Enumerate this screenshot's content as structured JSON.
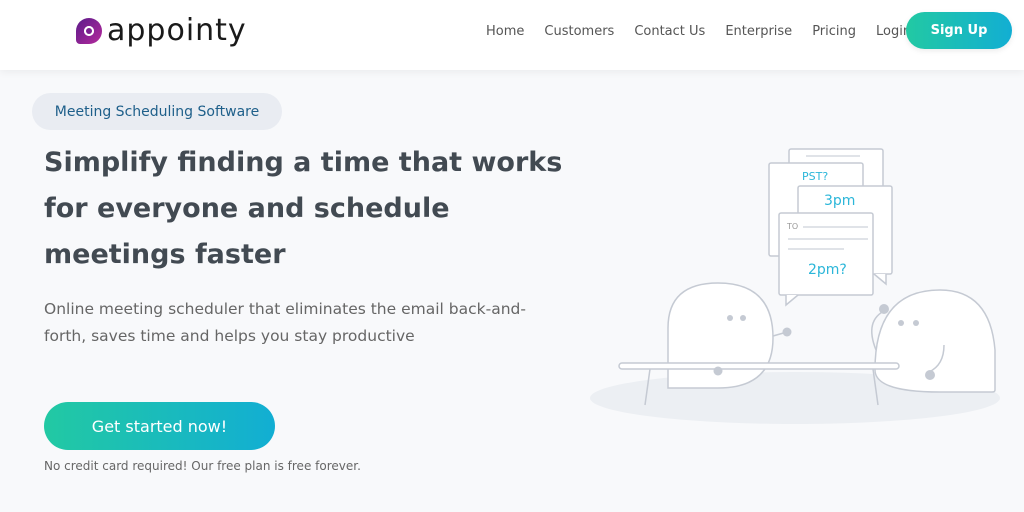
{
  "brand": {
    "name": "appointy",
    "accent_start": "#22c9a3",
    "accent_end": "#12aed3",
    "logo_color": "#7a2090"
  },
  "nav": {
    "items": [
      {
        "label": "Home"
      },
      {
        "label": "Customers"
      },
      {
        "label": "Contact Us"
      },
      {
        "label": "Enterprise"
      },
      {
        "label": "Pricing"
      },
      {
        "label": "Login"
      }
    ],
    "signup_label": "Sign Up"
  },
  "hero": {
    "badge": "Meeting Scheduling Software",
    "headline": "Simplify finding a time that works for everyone and schedule meetings faster",
    "subtext": "Online meeting scheduler that eliminates the email back-and-forth, saves time and helps you stay productive",
    "cta_label": "Get started now!",
    "note": "No credit card required! Our free plan is free forever."
  },
  "illustration": {
    "bubble_pst": "PST?",
    "bubble_3pm": "3pm",
    "bubble_to": "TO",
    "bubble_2pm": "2pm?"
  }
}
